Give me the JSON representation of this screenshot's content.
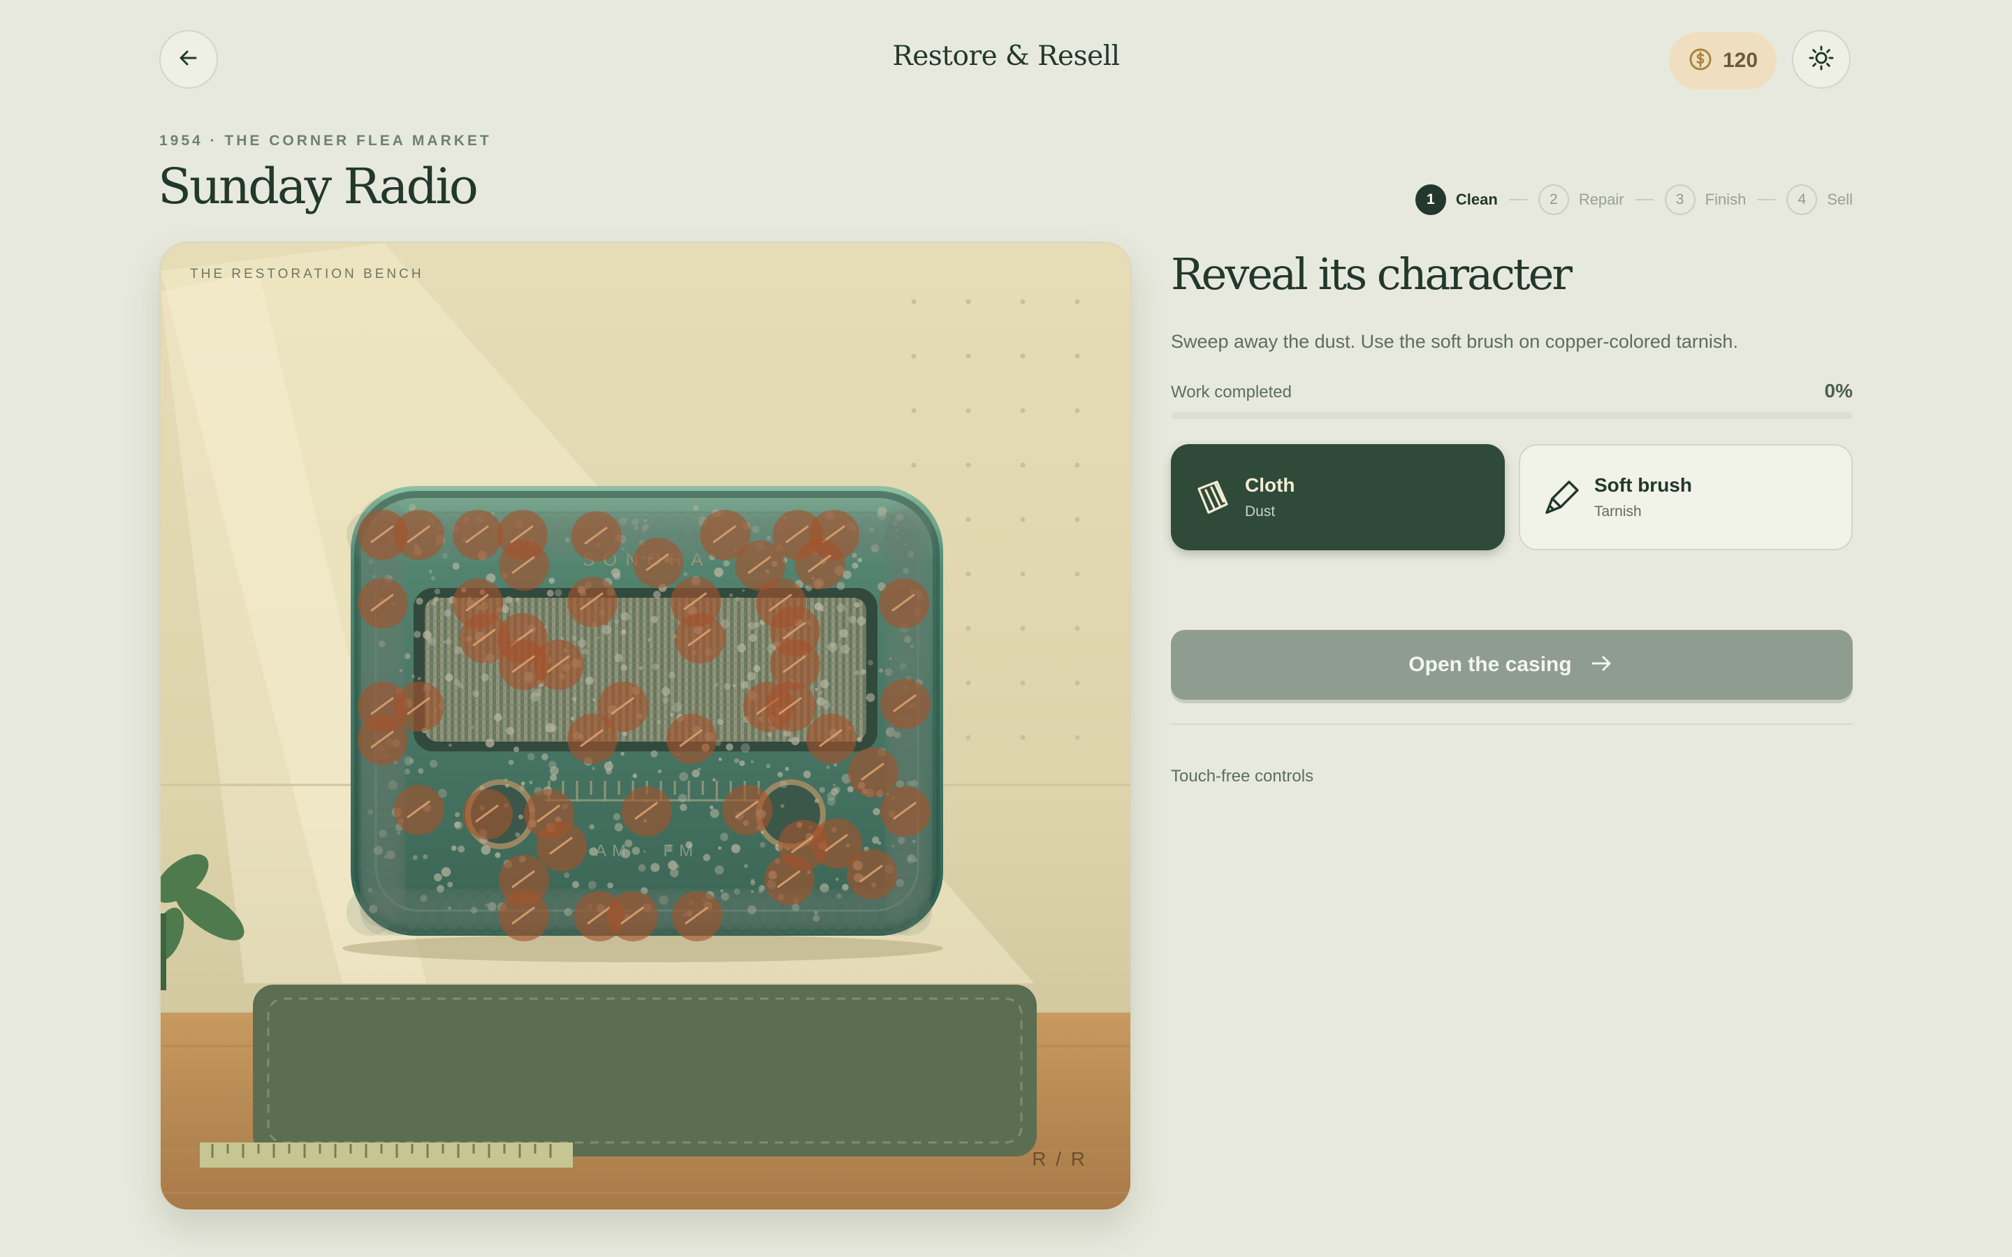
{
  "header": {
    "title": "Restore & Resell",
    "coins": "120",
    "icons": {
      "back": "arrow-left-icon",
      "coin": "dollar-coin-icon",
      "theme": "sun-icon"
    }
  },
  "page": {
    "eyebrow": "1954 · THE CORNER FLEA MARKET",
    "title": "Sunday Radio"
  },
  "stepper": {
    "steps": [
      {
        "num": "1",
        "label": "Clean",
        "active": true
      },
      {
        "num": "2",
        "label": "Repair",
        "active": false
      },
      {
        "num": "3",
        "label": "Finish",
        "active": false
      },
      {
        "num": "4",
        "label": "Sell",
        "active": false
      }
    ]
  },
  "bench": {
    "label": "THE RESTORATION BENCH",
    "corner_mark": "R / R",
    "radio": {
      "brand": "SONORA",
      "bands": "AM · FM"
    }
  },
  "panel": {
    "title": "Reveal its character",
    "description": "Sweep away the dust. Use the soft brush on copper-colored tarnish.",
    "progress_label": "Work completed",
    "progress_value": "0%",
    "progress_fraction": 0,
    "tools": [
      {
        "name": "Cloth",
        "target": "Dust",
        "icon": "cloth-icon",
        "selected": true
      },
      {
        "name": "Soft brush",
        "target": "Tarnish",
        "icon": "brush-icon",
        "selected": false
      }
    ],
    "cta_label": "Open the casing",
    "footer_note": "Touch-free controls"
  },
  "colors": {
    "background": "#e8e9de",
    "ink": "#22382c",
    "accent_dark_green": "#2f4a38",
    "radio_teal": "#3e7a68",
    "tarnish_copper": "#a5532c",
    "coin_bg": "#efdfc0"
  }
}
